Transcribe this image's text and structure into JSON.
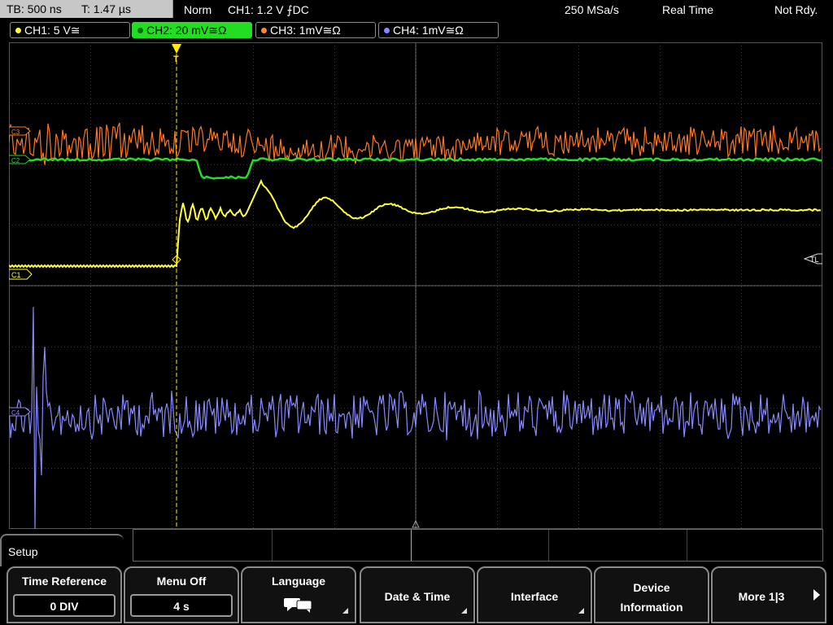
{
  "topbar": {
    "timebase": "TB: 500 ns",
    "trigger_time": "T: 1.47 µs",
    "mode": "Norm",
    "trigger": "CH1: 1.2 V ⨍DC",
    "sample_rate": "250 MSa/s",
    "acq_mode": "Real Time",
    "status": "Not Rdy."
  },
  "channels": [
    {
      "label": "CH1: 5 V≅",
      "color": "#ffff33"
    },
    {
      "label": "CH2: 20 mV≅Ω",
      "color": "#22dd22"
    },
    {
      "label": "CH3: 1mV≅Ω",
      "color": "#ff8833"
    },
    {
      "label": "CH4: 1mV≅Ω",
      "color": "#8888ff"
    }
  ],
  "markers": {
    "ch3": "C3",
    "ch2": "C2",
    "ch1": "C1",
    "ch4": "C4",
    "trigger_level": "TL",
    "trigger_pos": "T"
  },
  "colors": {
    "ch1": "#ffff33",
    "ch2": "#22dd22",
    "ch3": "#ff7722",
    "ch4": "#8888ff",
    "grid": "#3a3a3a",
    "trigger": "#ffee00"
  },
  "menu": {
    "title": "Setup",
    "softkeys": [
      {
        "label": "Time Reference",
        "value": "0 DIV"
      },
      {
        "label": "Menu Off",
        "value": "4 s"
      },
      {
        "label": "Language",
        "icon": "speech-bubbles-icon"
      },
      {
        "label": "Date & Time"
      },
      {
        "label": "Interface"
      },
      {
        "label": "Device\nInformation",
        "line1": "Device",
        "line2": "Information"
      },
      {
        "label": "More 1|3"
      }
    ]
  }
}
